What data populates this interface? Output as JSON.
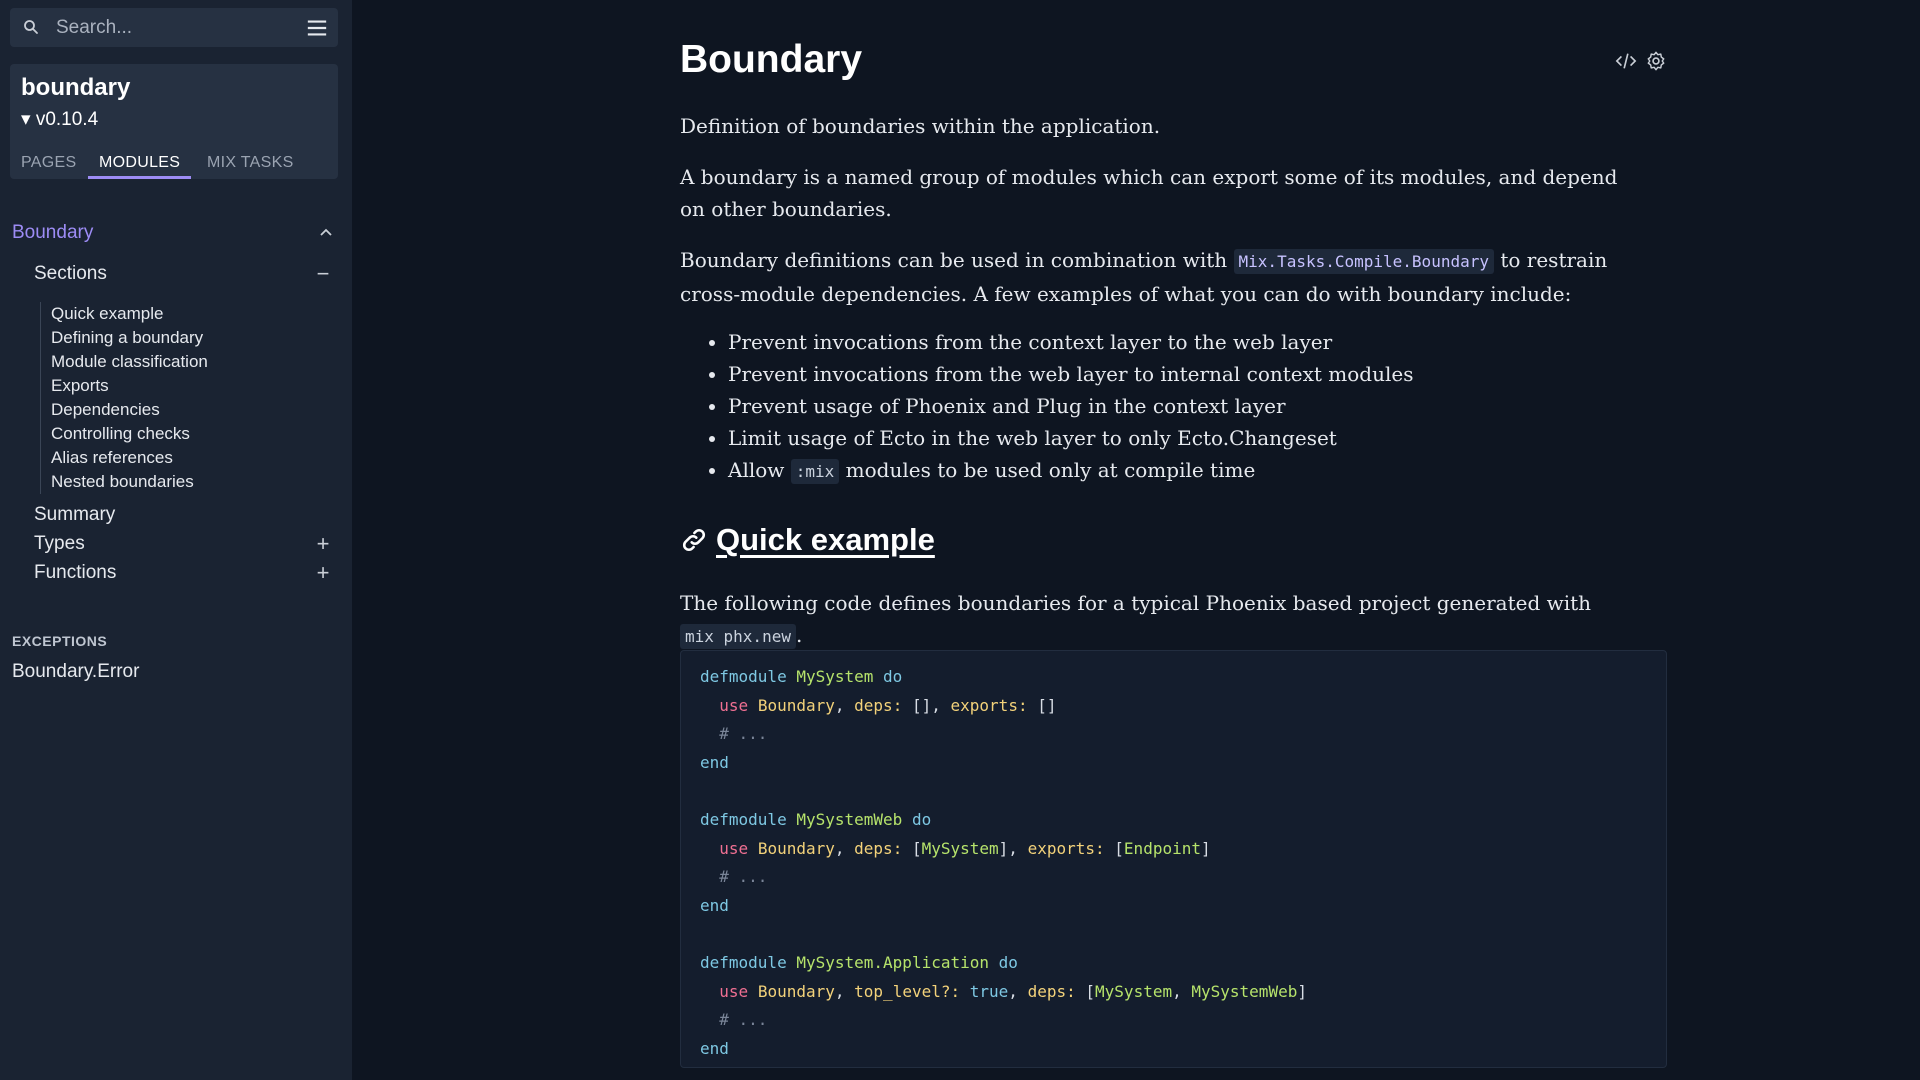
{
  "sidebar": {
    "search_placeholder": "Search...",
    "project_name": "boundary",
    "project_version": "▾ v0.10.4",
    "tabs": [
      {
        "label": "PAGES"
      },
      {
        "label": "MODULES"
      },
      {
        "label": "MIX TASKS"
      }
    ],
    "nav": {
      "module_label": "Boundary",
      "module_ctrl": "^",
      "sections_label": "Sections",
      "sections_ctrl": "−",
      "section_items": [
        "Quick example",
        "Defining a boundary",
        "Module classification",
        "Exports",
        "Dependencies",
        "Controlling checks",
        "Alias references",
        "Nested boundaries"
      ],
      "summary_label": "Summary",
      "types_label": "Types",
      "types_ctrl": "+",
      "functions_label": "Functions",
      "functions_ctrl": "+"
    },
    "exceptions_heading": "EXCEPTIONS",
    "exceptions_item": "Boundary.Error"
  },
  "content": {
    "title": "Boundary",
    "p1": "Definition of boundaries within the application.",
    "p2": "A boundary is a named group of modules which can export some of its modules, and depend on other boundaries.",
    "p3_before": "Boundary definitions can be used in combination with ",
    "p3_code": "Mix.Tasks.Compile.Boundary",
    "p3_after": " to restrain cross-module dependencies. A few examples of what you can do with boundary include:",
    "bullets": [
      "Prevent invocations from the context layer to the web layer",
      "Prevent invocations from the web layer to internal context modules",
      "Prevent usage of Phoenix and Plug in the context layer",
      "Limit usage of Ecto in the web layer to only Ecto.Changeset"
    ],
    "bullet5_before": "Allow ",
    "bullet5_code": ":mix",
    "bullet5_after": " modules to be used only at compile time",
    "section_title": "Quick example",
    "p4_before": "The following code defines boundaries for a typical Phoenix based project generated with ",
    "p4_code": "mix phx.new",
    "p4_after": ".",
    "code": {
      "defmodule": "defmodule",
      "do": "do",
      "end": "end",
      "use": "use",
      "mod1": "MySystem",
      "mod2": "MySystemWeb",
      "mod3": "MySystem.Application",
      "boundary": "Boundary",
      "deps": "deps:",
      "exports": "exports:",
      "top_level": "top_level?:",
      "true": "true",
      "comment": "# ...",
      "empty_list": "[]",
      "endpoint": "Endpoint"
    }
  }
}
